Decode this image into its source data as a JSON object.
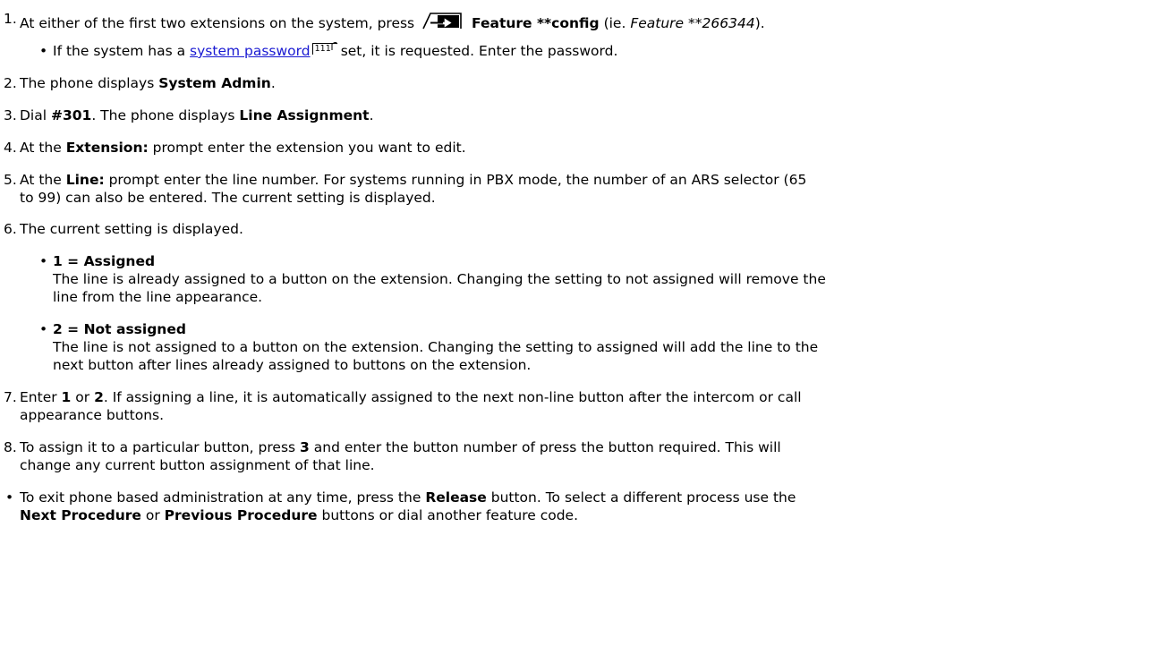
{
  "steps": [
    {
      "num": "1.",
      "pre": "At either of the first two extensions on the system, press",
      "bold": "Feature **config",
      "mid": "(ie.",
      "italic": "Feature **266344",
      "post": ")."
    },
    {
      "bullet": {
        "pre": "If the system has a",
        "link": "system password",
        "ref": "111",
        "post": "set, it is requested. Enter the password."
      }
    },
    {
      "num": "2.",
      "pre": "The phone displays",
      "bold": "System Admin",
      "post": "."
    },
    {
      "num": "3.",
      "pre": "Dial",
      "bold1": "#301",
      "mid": ". The phone displays",
      "bold2": "Line Assignment",
      "post": "."
    },
    {
      "num": "4.",
      "pre": "At the",
      "bold": "Extension:",
      "post": "prompt enter the extension you want to edit."
    },
    {
      "num": "5.",
      "pre": "At the",
      "bold": "Line:",
      "post": "prompt enter the line number. For systems running in PBX mode, the number of an ARS selector (65",
      "line2": "to 99) can also be entered. The current setting is displayed."
    },
    {
      "num": "6.",
      "text": "The current setting is displayed."
    }
  ],
  "options": [
    {
      "title": "1 = Assigned",
      "line1": "The line is already assigned to a button on the extension. Changing the setting to not assigned will remove the",
      "line2": "line from the line appearance."
    },
    {
      "title": "2 = Not assigned",
      "line1": "The line is not assigned to a button on the extension. Changing the setting to assigned will add the line to the",
      "line2": "next button after lines already assigned to buttons on the extension."
    }
  ],
  "step7": {
    "num": "7.",
    "pre": "Enter",
    "b1": "1",
    "or": "or",
    "b2": "2",
    "post": ". If assigning a line, it is automatically assigned to the next non-line button after the intercom or call",
    "line2": "appearance buttons."
  },
  "step8": {
    "num": "8.",
    "pre": "To assign it to a particular button, press",
    "b1": "3",
    "post": "and enter the button number of press the button required. This will",
    "line2": "change any current button assignment of that line."
  },
  "footer": {
    "pre": "To exit phone based administration at any time, press the",
    "b1": "Release",
    "post": "button. To select a different process use the",
    "b2": "Next Procedure",
    "or": "or",
    "b3": "Previous Procedure",
    "post2": "buttons or dial another feature code."
  },
  "icons": {
    "feature_button": "feature-button-icon",
    "topic_link": "topic-link-icon"
  }
}
